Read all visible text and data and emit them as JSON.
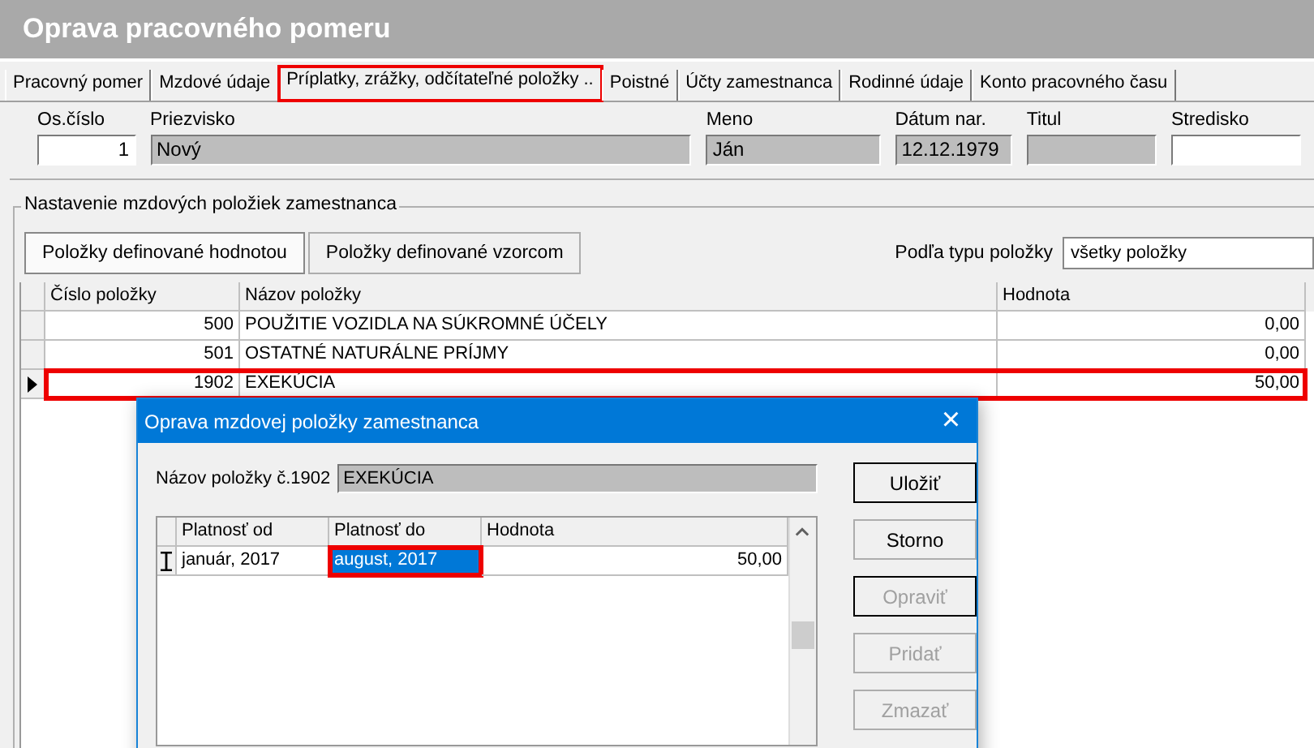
{
  "window": {
    "title": "Oprava pracovného pomeru"
  },
  "tabs": [
    {
      "label": "Pracovný pomer",
      "selected": false,
      "highlighted": false
    },
    {
      "label": "Mzdové údaje",
      "selected": false,
      "highlighted": false
    },
    {
      "label": "Príplatky, zrážky, odčítateľné položky ..",
      "selected": true,
      "highlighted": true
    },
    {
      "label": "Poistné",
      "selected": false,
      "highlighted": false
    },
    {
      "label": "Účty zamestnanca",
      "selected": false,
      "highlighted": false
    },
    {
      "label": "Rodinné údaje",
      "selected": false,
      "highlighted": false
    },
    {
      "label": "Konto pracovného času",
      "selected": false,
      "highlighted": false
    }
  ],
  "header_fields": [
    {
      "label": "Os.číslo",
      "value": "1",
      "kind": "number"
    },
    {
      "label": "Priezvisko",
      "value": "Nový",
      "kind": "readonly"
    },
    {
      "label": "Meno",
      "value": "Ján",
      "kind": "readonly"
    },
    {
      "label": "Dátum nar.",
      "value": "12.12.1979",
      "kind": "readonly"
    },
    {
      "label": "Titul",
      "kind": "readonly"
    },
    {
      "label": "Stredisko",
      "kind": "input"
    }
  ],
  "group": {
    "title": "Nastavenie mzdových položiek zamestnanca",
    "mode_buttons": [
      {
        "label": "Položky definované hodnotou",
        "selected": true
      },
      {
        "label": "Položky definované vzorcom",
        "selected": false
      }
    ],
    "filter": {
      "label": "Podľa typu položky",
      "value": "všetky položky"
    },
    "table": {
      "columns": [
        "Číslo položky",
        "Názov položky",
        "Hodnota"
      ],
      "rows": [
        {
          "number": "500",
          "name": "POUŽITIE VOZIDLA NA SÚKROMNÉ ÚČELY",
          "value": "0,00",
          "current": false,
          "highlighted": false
        },
        {
          "number": "501",
          "name": "OSTATNÉ NATURÁLNE PRÍJMY",
          "value": "0,00",
          "current": false,
          "highlighted": false
        },
        {
          "number": "1902",
          "name": "EXEKÚCIA",
          "value": "50,00",
          "current": true,
          "highlighted": true
        }
      ]
    }
  },
  "dialog": {
    "title": "Oprava mzdovej položky zamestnanca",
    "close": "×",
    "name_label": "Názov položky č.1902",
    "name_value": "EXEKÚCIA",
    "columns": [
      "Platnosť od",
      "Platnosť do",
      "Hodnota"
    ],
    "rows": [
      {
        "from": "január, 2017",
        "to": "august, 2017",
        "value": "50,00",
        "editing": true,
        "to_selected": true,
        "to_highlighted": true
      }
    ],
    "buttons": [
      {
        "label": "Uložiť",
        "disabled": false,
        "default": true
      },
      {
        "label": "Storno",
        "disabled": false,
        "default": false
      },
      {
        "label": "Opraviť",
        "disabled": true,
        "default": true
      },
      {
        "label": "Pridať",
        "disabled": true,
        "default": false
      },
      {
        "label": "Zmazať",
        "disabled": true,
        "default": false
      }
    ]
  }
}
